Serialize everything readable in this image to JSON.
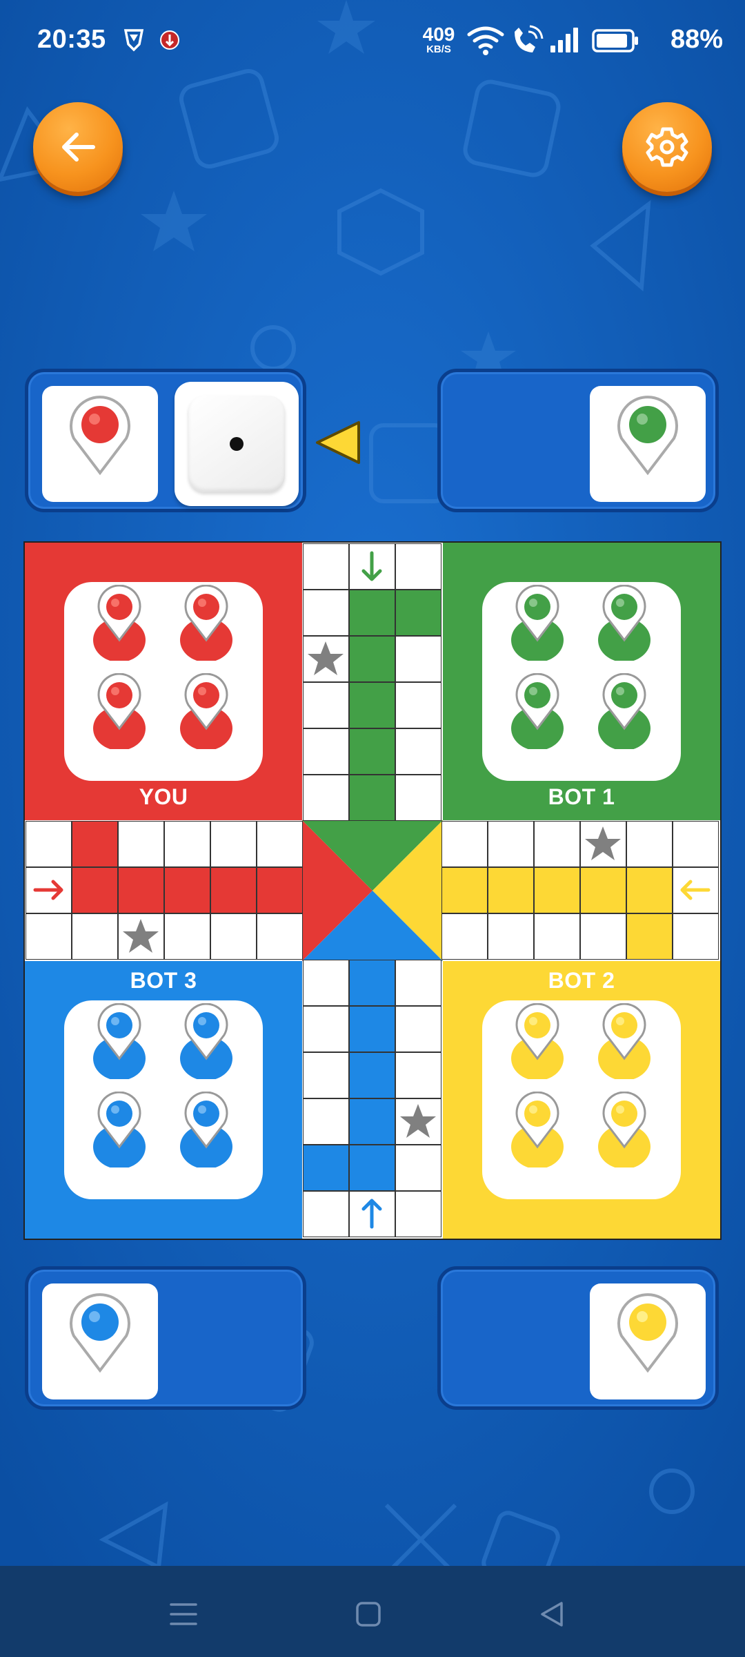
{
  "status_bar": {
    "time": "20:35",
    "speed_value": "409",
    "speed_unit": "KB/S",
    "battery_percent": "88%",
    "icons": [
      "vpn-shield-icon",
      "notification-icon",
      "wifi-icon",
      "wifi-calling-icon",
      "signal-icon",
      "battery-icon"
    ]
  },
  "header": {
    "back_icon": "arrow-left-icon",
    "settings_icon": "gear-icon"
  },
  "players": {
    "you": {
      "label": "YOU",
      "color": "#e53935"
    },
    "bot1": {
      "label": "BOT 1",
      "color": "#43a047"
    },
    "bot2": {
      "label": "BOT 2",
      "color": "#fdd835"
    },
    "bot3": {
      "label": "BOT 3",
      "color": "#1e88e5"
    }
  },
  "dice": {
    "value": 1,
    "turn_indicator_color": "#fdd835"
  },
  "board": {
    "safe_star_color": "#808080",
    "tokens_in_yard": {
      "red": 4,
      "green": 4,
      "yellow": 4,
      "blue": 4
    }
  },
  "colors": {
    "background": "#0f5cb5",
    "panel": "#1865c9",
    "button": "#f7931e",
    "nav_bar": "#123b6b"
  },
  "nav_bar": {
    "icons": [
      "menu-icon",
      "home-icon",
      "back-triangle-icon"
    ]
  }
}
